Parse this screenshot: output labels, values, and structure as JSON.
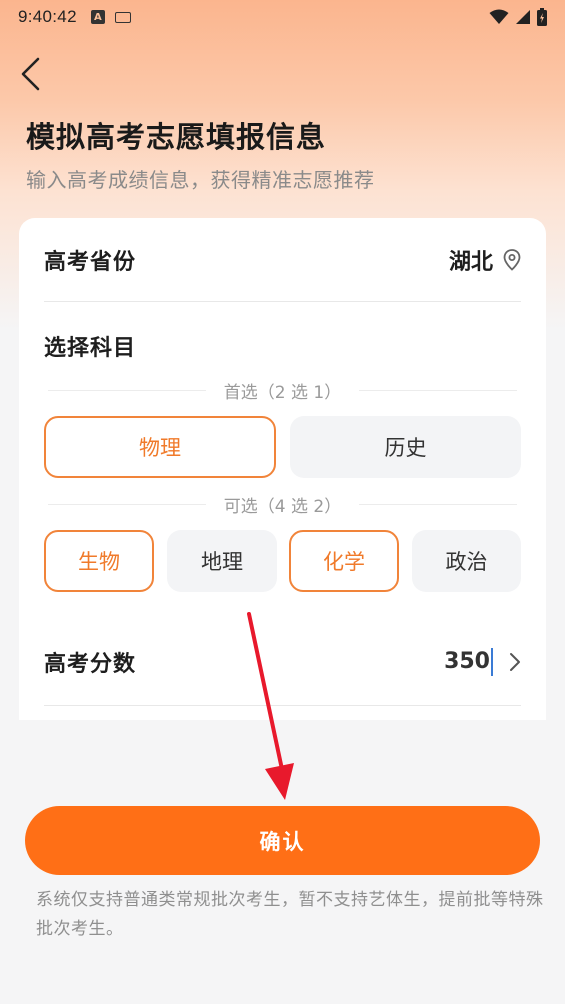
{
  "status_bar": {
    "time": "9:40:42",
    "icons": [
      "a-icon",
      "keyboard-icon",
      "wifi-icon",
      "signal-icon",
      "battery-icon"
    ]
  },
  "header": {
    "title": "模拟高考志愿填报信息",
    "subtitle": "输入高考成绩信息，获得精准志愿推荐"
  },
  "province": {
    "label": "高考省份",
    "value": "湖北",
    "icon": "location-pin-icon"
  },
  "subjects": {
    "label": "选择科目",
    "primary_group_label": "首选（2 选 1）",
    "primary_options": [
      {
        "label": "物理",
        "selected": true
      },
      {
        "label": "历史",
        "selected": false
      }
    ],
    "elective_group_label": "可选（4 选 2）",
    "elective_options": [
      {
        "label": "生物",
        "selected": true
      },
      {
        "label": "地理",
        "selected": false
      },
      {
        "label": "化学",
        "selected": true
      },
      {
        "label": "政治",
        "selected": false
      }
    ]
  },
  "score": {
    "label": "高考分数",
    "value": "350",
    "icon": "chevron-right-icon"
  },
  "confirm_button": {
    "label": "确认"
  },
  "notice": "系统仅支持普通类常规批次考生，暂不支持艺体生，提前批等特殊批次考生。",
  "colors": {
    "accent": "#ff6f16",
    "chip_selected_border": "#f1843a",
    "chip_selected_text": "#f07a2a",
    "annotation_arrow": "#e8192c"
  }
}
